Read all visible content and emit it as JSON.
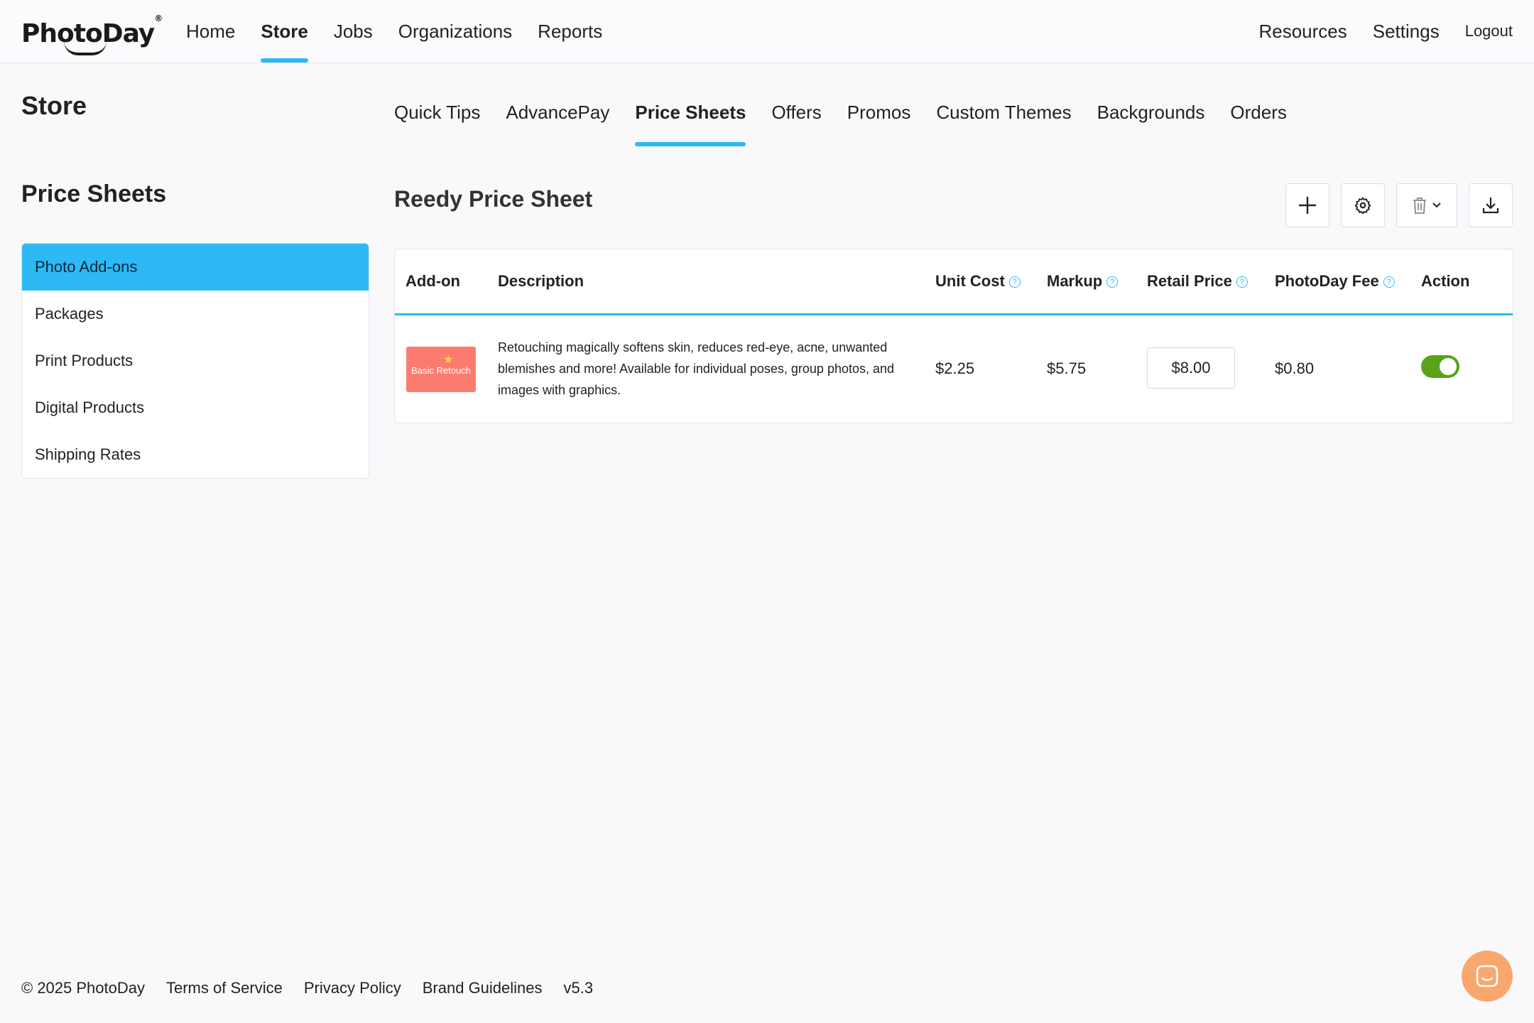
{
  "brand": {
    "logo_text": "PhotoDay",
    "trademark": "®"
  },
  "topnav": {
    "left": [
      {
        "label": "Home",
        "active": false
      },
      {
        "label": "Store",
        "active": true
      },
      {
        "label": "Jobs",
        "active": false
      },
      {
        "label": "Organizations",
        "active": false
      },
      {
        "label": "Reports",
        "active": false
      }
    ],
    "right": [
      {
        "label": "Resources"
      },
      {
        "label": "Settings"
      },
      {
        "label": "Logout"
      }
    ]
  },
  "page": {
    "title": "Store"
  },
  "subnav": [
    {
      "label": "Quick Tips",
      "active": false
    },
    {
      "label": "AdvancePay",
      "active": false
    },
    {
      "label": "Price Sheets",
      "active": true
    },
    {
      "label": "Offers",
      "active": false
    },
    {
      "label": "Promos",
      "active": false
    },
    {
      "label": "Custom Themes",
      "active": false
    },
    {
      "label": "Backgrounds",
      "active": false
    },
    {
      "label": "Orders",
      "active": false
    }
  ],
  "sidebar": {
    "title": "Price Sheets",
    "items": [
      {
        "label": "Photo Add-ons",
        "active": true
      },
      {
        "label": "Packages",
        "active": false
      },
      {
        "label": "Print Products",
        "active": false
      },
      {
        "label": "Digital Products",
        "active": false
      },
      {
        "label": "Shipping Rates",
        "active": false
      }
    ]
  },
  "sheet": {
    "title": "Reedy Price Sheet",
    "toolbar": {
      "icons": [
        "plus-icon",
        "gear-icon",
        "trash-icon",
        "chevron-down-icon",
        "download-icon"
      ]
    }
  },
  "table": {
    "headers": {
      "addon": "Add-on",
      "description": "Description",
      "unit_cost": "Unit Cost",
      "markup": "Markup",
      "retail_price": "Retail Price",
      "photoday_fee": "PhotoDay Fee",
      "action": "Action"
    },
    "help_icon": "?",
    "rows": [
      {
        "thumb_text": "Basic Retouch",
        "description": "Retouching magically softens skin, reduces red-eye, acne, unwanted blemishes and more! Available for individual poses, group photos, and images with graphics.",
        "unit_cost": "$2.25",
        "markup": "$5.75",
        "retail_price": "$8.00",
        "photoday_fee": "$0.80",
        "enabled": true
      }
    ]
  },
  "footer": {
    "copyright": "© 2025 PhotoDay",
    "links": [
      "Terms of Service",
      "Privacy Policy",
      "Brand Guidelines"
    ],
    "version": "v5.3"
  },
  "colors": {
    "accent": "#2db9f5",
    "toggle_on": "#5aa21a",
    "chat": "#fba66e",
    "thumb": "#fb7c6e"
  }
}
